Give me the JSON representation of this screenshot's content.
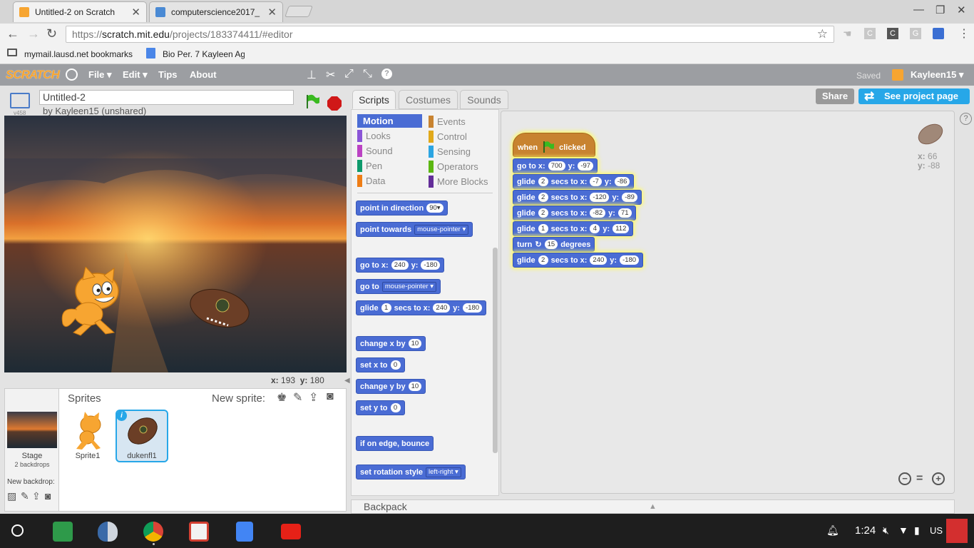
{
  "browser": {
    "tabs": [
      {
        "title": "Untitled-2 on Scratch",
        "active": true
      },
      {
        "title": "computerscience2017_"
      }
    ],
    "url_prefix": "https://",
    "url_host": "scratch.mit.edu",
    "url_path": "/projects/183374411/#editor",
    "bookmarks": [
      {
        "label": "mymail.lausd.net bookmarks"
      },
      {
        "label": "Bio Per. 7 Kayleen Ag"
      }
    ],
    "ext_letters": [
      "C",
      "C",
      "G"
    ]
  },
  "menubar": {
    "logo": "SCRATCH",
    "items": [
      "File ▾",
      "Edit ▾",
      "Tips",
      "About"
    ],
    "saved": "Saved",
    "user": "Kayleen15 ▾"
  },
  "project": {
    "title": "Untitled-2",
    "version": "v458",
    "byline": "by Kayleen15 (unshared)",
    "mouse_x_label": "x:",
    "mouse_x": "193",
    "mouse_y_label": "y:",
    "mouse_y": "180"
  },
  "sprites": {
    "header": "Sprites",
    "new_sprite": "New sprite:",
    "stage_label": "Stage",
    "stage_backdrops": "2 backdrops",
    "new_backdrop": "New backdrop:",
    "items": [
      {
        "name": "Sprite1"
      },
      {
        "name": "dukenfl1",
        "selected": true
      }
    ]
  },
  "tabs": [
    "Scripts",
    "Costumes",
    "Sounds"
  ],
  "actions": {
    "share": "Share",
    "see_project": "See project page"
  },
  "categories_left": [
    {
      "label": "Motion",
      "color": "#4a6cd4",
      "active": true
    },
    {
      "label": "Looks",
      "color": "#8a55d7"
    },
    {
      "label": "Sound",
      "color": "#bb42c3"
    },
    {
      "label": "Pen",
      "color": "#0e9a6c"
    },
    {
      "label": "Data",
      "color": "#ee7d16"
    }
  ],
  "categories_right": [
    {
      "label": "Events",
      "color": "#c88330"
    },
    {
      "label": "Control",
      "color": "#e1a91a"
    },
    {
      "label": "Sensing",
      "color": "#2ca5e2"
    },
    {
      "label": "Operators",
      "color": "#5cb712"
    },
    {
      "label": "More Blocks",
      "color": "#632d99"
    }
  ],
  "palette": {
    "point_dir": {
      "t1": "point in direction",
      "v": "90▾"
    },
    "point_towards": {
      "t1": "point towards",
      "v": "mouse-pointer ▾"
    },
    "goto_xy": {
      "t1": "go to x:",
      "x": "240",
      "t2": "y:",
      "y": "-180"
    },
    "goto": {
      "t1": "go to",
      "v": "mouse-pointer ▾"
    },
    "glide": {
      "t1": "glide",
      "s": "1",
      "t2": "secs to x:",
      "x": "240",
      "t3": "y:",
      "y": "-180"
    },
    "change_x": {
      "t1": "change x by",
      "v": "10"
    },
    "set_x": {
      "t1": "set x to",
      "v": "0"
    },
    "change_y": {
      "t1": "change y by",
      "v": "10"
    },
    "set_y": {
      "t1": "set y to",
      "v": "0"
    },
    "bounce": {
      "t1": "if on edge, bounce"
    },
    "rotation": {
      "t1": "set rotation style",
      "v": "left-right ▾"
    }
  },
  "script": {
    "hat": {
      "t1": "when",
      "t2": "clicked"
    },
    "goto": {
      "t1": "go to x:",
      "x": "700",
      "t2": "y:",
      "y": "-97"
    },
    "glide1": {
      "t1": "glide",
      "s": "2",
      "t2": "secs to x:",
      "x": "-7",
      "t3": "y:",
      "y": "-86"
    },
    "glide2": {
      "t1": "glide",
      "s": "2",
      "t2": "secs to x:",
      "x": "-120",
      "t3": "y:",
      "y": "-89"
    },
    "glide3": {
      "t1": "glide",
      "s": "2",
      "t2": "secs to x:",
      "x": "-82",
      "t3": "y:",
      "y": "71"
    },
    "glide4": {
      "t1": "glide",
      "s": "1",
      "t2": "secs to x:",
      "x": "4",
      "t3": "y:",
      "y": "112"
    },
    "turn": {
      "t1": "turn",
      "v": "15",
      "t2": "degrees"
    },
    "glide5": {
      "t1": "glide",
      "s": "2",
      "t2": "secs to x:",
      "x": "240",
      "t3": "y:",
      "y": "-180"
    }
  },
  "sprite_info": {
    "x_label": "x:",
    "x": "66",
    "y_label": "y:",
    "y": "-88"
  },
  "backpack": "Backpack",
  "taskbar": {
    "time": "1:24",
    "locale": "US"
  }
}
